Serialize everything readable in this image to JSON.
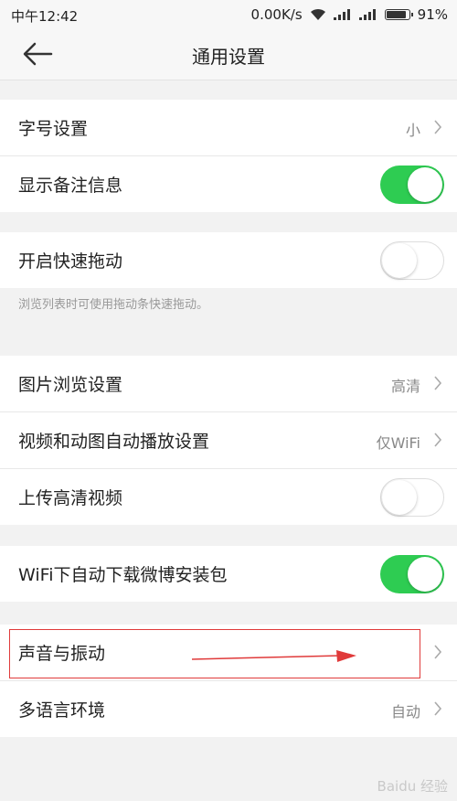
{
  "status_bar": {
    "time": "中午12:42",
    "network_speed": "0.00K/s",
    "battery_percent": "91%",
    "battery_level": 0.91
  },
  "header": {
    "title": "通用设置"
  },
  "settings": {
    "font_size": {
      "label": "字号设置",
      "value": "小"
    },
    "show_remark": {
      "label": "显示备注信息",
      "on": true
    },
    "quick_drag": {
      "label": "开启快速拖动",
      "on": false,
      "hint": "浏览列表时可使用拖动条快速拖动。"
    },
    "image_browse": {
      "label": "图片浏览设置",
      "value": "高清"
    },
    "video_autoplay": {
      "label": "视频和动图自动播放设置",
      "value": "仅WiFi"
    },
    "hd_upload": {
      "label": "上传高清视频",
      "on": false
    },
    "wifi_download": {
      "label": "WiFi下自动下载微博安装包",
      "on": true
    },
    "sound_vibration": {
      "label": "声音与振动"
    },
    "language": {
      "label": "多语言环境",
      "value": "自动"
    }
  },
  "colors": {
    "toggle_on": "#2ecc52",
    "annotation": "#e03a3a"
  },
  "watermark": "Baidu 经验"
}
